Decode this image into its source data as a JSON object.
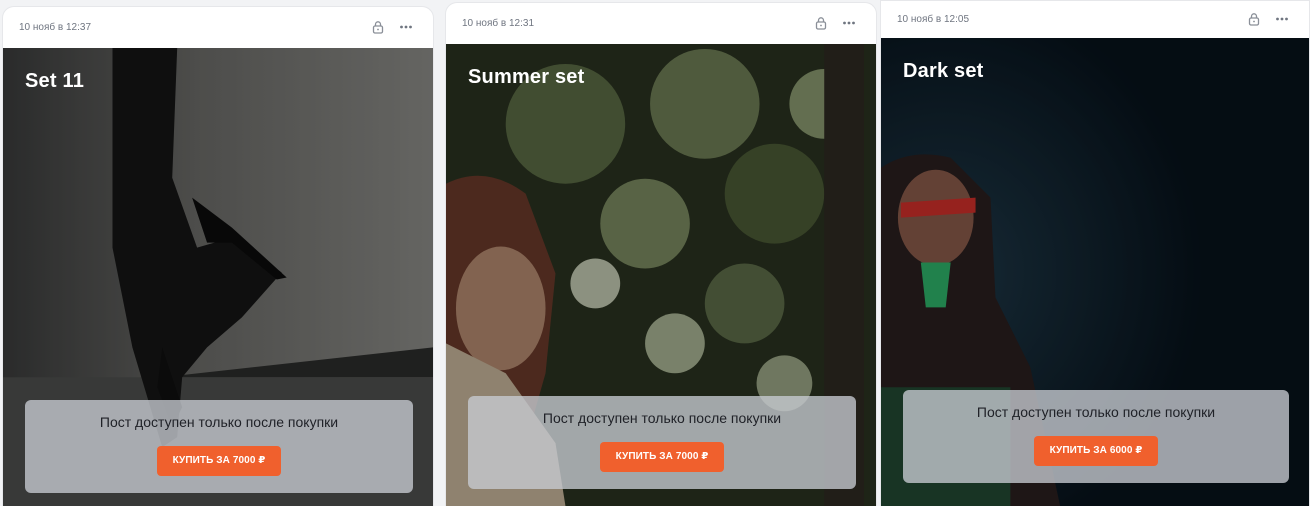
{
  "icons": {
    "lock": "lock-icon",
    "more": "more-icon"
  },
  "accent_color": "#f0602d",
  "posts": [
    {
      "date": "10 нояб в 12:37",
      "title": "Set 11",
      "paywall_text": "Пост доступен только после покупки",
      "buy_label": "КУПИТЬ ЗА 7000 ₽"
    },
    {
      "date": "10 нояб в 12:31",
      "title": "Summer set",
      "paywall_text": "Пост доступен только после покупки",
      "buy_label": "КУПИТЬ ЗА 7000 ₽"
    },
    {
      "date": "10 нояб в 12:05",
      "title": "Dark set",
      "paywall_text": "Пост доступен только после покупки",
      "buy_label": "КУПИТЬ ЗА 6000 ₽"
    }
  ]
}
